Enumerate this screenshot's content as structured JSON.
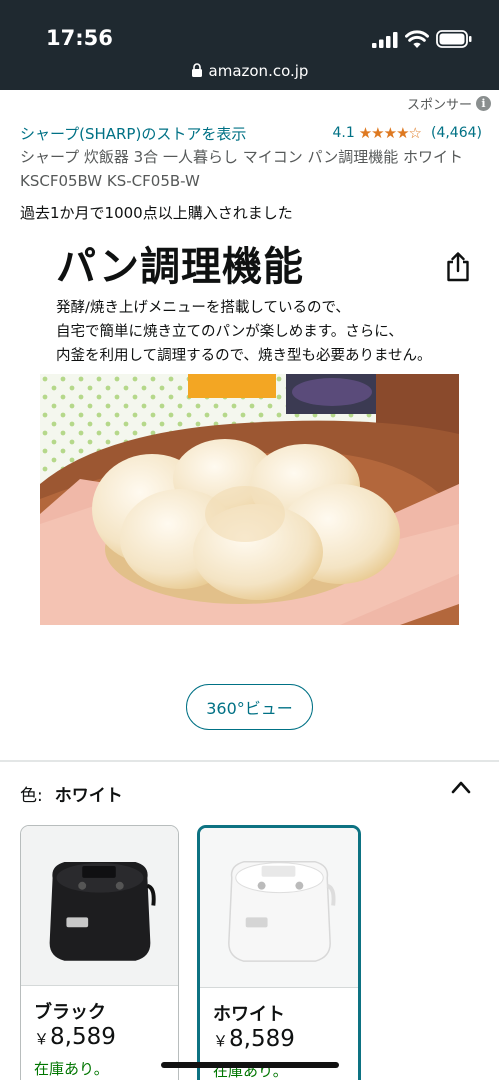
{
  "status_bar": {
    "time": "17:56"
  },
  "browser": {
    "url": "amazon.co.jp"
  },
  "sponsor": {
    "label": "スポンサー"
  },
  "store": {
    "link_text": "シャープ(SHARP)のストアを表示",
    "rating": "4.1",
    "stars": 4,
    "review_count": "(4,464)"
  },
  "product": {
    "title": "シャープ 炊飯器 3合 一人暮らし マイコン パン調理機能 ホワイト KSCF05BW KS-CF05B-W",
    "bought_text": "過去1か月で1000点以上購入されました"
  },
  "hero": {
    "heading": "パン調理機能",
    "description": [
      "発酵/焼き上げメニューを搭載しているので、",
      "自宅で簡単に焼き立てのパンが楽しめます。さらに、",
      "内釜を利用して調理するので、焼き型も必要ありません。"
    ]
  },
  "carousel": {
    "total": 8,
    "active_index": 3,
    "video_index": 5
  },
  "view360": {
    "label": "360°ビュー"
  },
  "color_selector": {
    "label": "色:",
    "selected_value": "ホワイト",
    "options": [
      {
        "name": "ブラック",
        "currency": "￥",
        "price": "8,589",
        "stock": "在庫あり。"
      },
      {
        "name": "ホワイト",
        "currency": "￥",
        "price": "8,589",
        "stock": "在庫あり。"
      }
    ]
  },
  "colors": {
    "link": "#007185",
    "star": "#de7921",
    "stock": "#007600",
    "status_bar": "#1f2930",
    "selected_border": "#0d7282"
  }
}
